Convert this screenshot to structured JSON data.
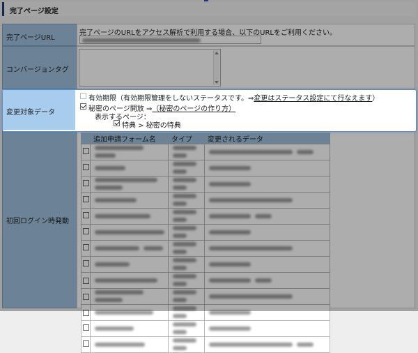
{
  "title": "完了ページ設定",
  "rows": {
    "url": {
      "label": "完了ページURL",
      "description": "完了ページのURLをアクセス解析で利用する場合、以下のURLをご利用ください。"
    },
    "conversion": {
      "label": "コンバージョンタグ"
    },
    "change_target": {
      "label": "変更対象データ",
      "expiry": {
        "text": "有効期限（有効期限管理をしないステータスです。⇒",
        "link": "変更はステータス設定にて行なえます",
        "close": "）",
        "checked": false
      },
      "secret": {
        "text": "秘密のページ開放 ⇒",
        "link": "（秘密のページの作り方）",
        "checked": true
      },
      "display_label": "表示するページ：",
      "page_item": {
        "text": "特典 > 秘密の特典",
        "checked": true
      }
    },
    "first_login": {
      "label": "初回ログイン時発動",
      "headers": [
        "追加申請フォーム名",
        "タイプ",
        "変更されるデータ"
      ],
      "row_count": 13
    }
  },
  "colors": {
    "label_bg": "#9fc1df",
    "highlight_border": "#5a8fcc",
    "title_accent": "#1f3a74"
  }
}
